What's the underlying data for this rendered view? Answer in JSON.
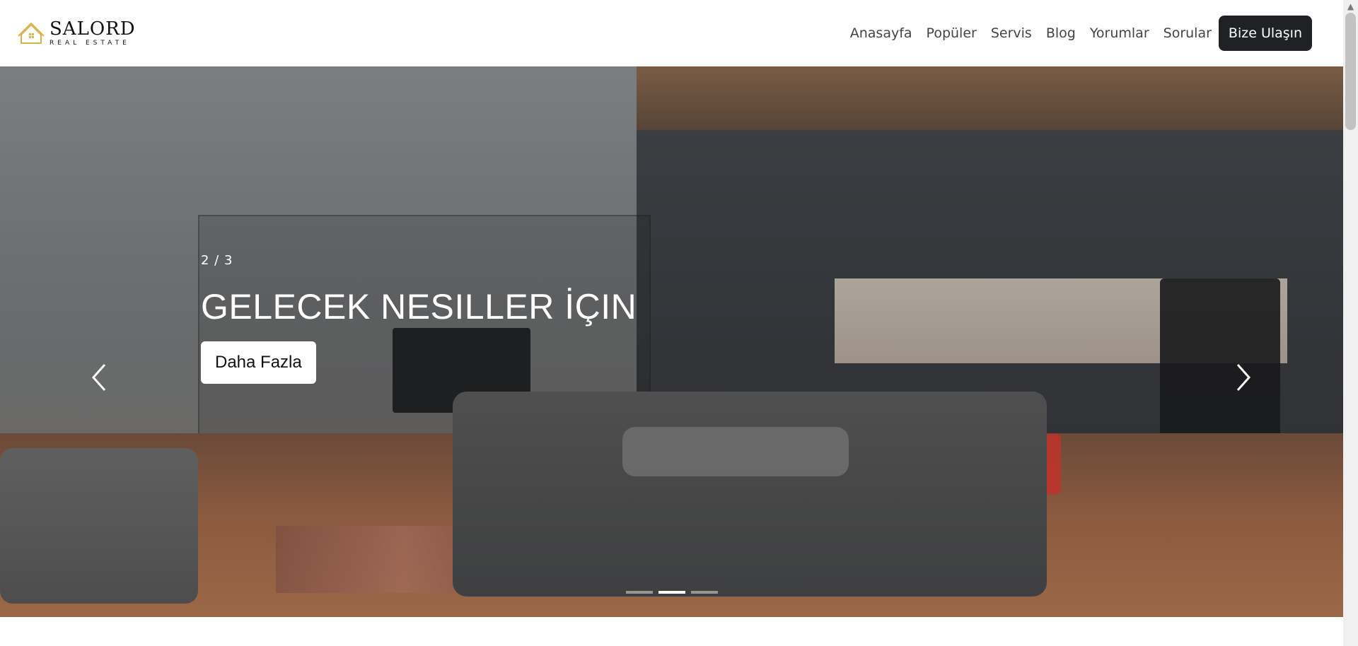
{
  "header": {
    "brand": {
      "name": "SALORD",
      "subtitle": "REAL ESTATE",
      "accent_color": "#d9b54a"
    },
    "nav": {
      "items": [
        "Anasayfa",
        "Popüler",
        "Servis",
        "Blog",
        "Yorumlar",
        "Sorular"
      ],
      "cta_label": "Bize Ulaşın",
      "cta_color": "#1f2124"
    }
  },
  "hero": {
    "counter": "2 / 3",
    "headline": "GELECEK NESILLER İÇIN",
    "button_label": "Daha Fazla",
    "prev_icon": "chevron-left-icon",
    "next_icon": "chevron-right-icon",
    "indicators": {
      "count": 3,
      "active_index": 1
    }
  }
}
